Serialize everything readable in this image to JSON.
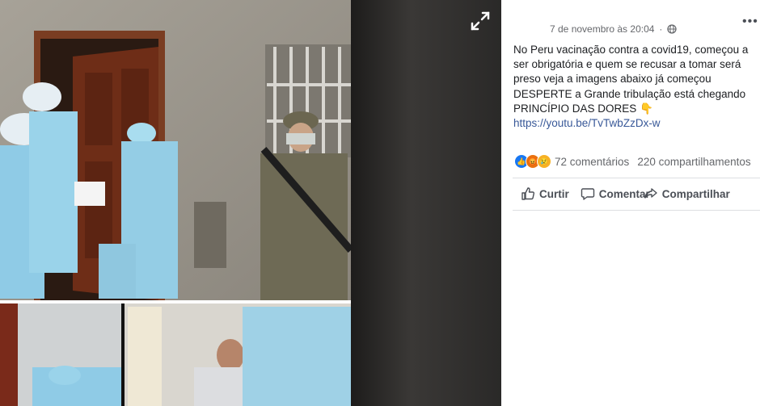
{
  "post": {
    "timestamp": "7 de novembro às 20:04",
    "privacy_icon": "globe-icon",
    "more_icon": "more-options-icon",
    "text_lines": [
      "No Peru vacinação contra a covid19, começou a",
      "ser obrigatória e quem se recusar a tomar será",
      "preso veja a imagens abaixo já começou",
      "DESPERTE a Grande tribulação está chegando",
      "PRINCÍPIO DAS DORES 👇"
    ],
    "link": "https://youtu.be/TvTwbZzDx-w"
  },
  "stats": {
    "reaction_icons": [
      "like-icon",
      "angry-icon",
      "sad-icon"
    ],
    "comments": "72 comentários",
    "shares": "220 compartilhamentos"
  },
  "actions": {
    "like": "Curtir",
    "comment": "Comentar",
    "share": "Compartilhar"
  },
  "viewer": {
    "expand_icon": "expand-icon"
  },
  "colors": {
    "link": "#385898",
    "like_blue": "#1877f2",
    "viewer_bg": "#2f2e2d"
  }
}
